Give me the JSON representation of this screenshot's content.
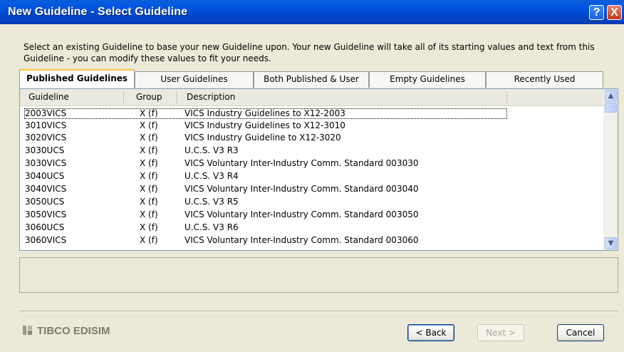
{
  "window": {
    "title": "New Guideline - Select Guideline",
    "help_glyph": "?",
    "close_glyph": "X"
  },
  "intro_text": "Select an existing Guideline to base your new Guideline upon. Your new Guideline will take all of its starting values and text from this Guideline - you can modify these values to fit your needs.",
  "tabs": [
    {
      "label": "Published Guidelines",
      "active": true
    },
    {
      "label": "User Guidelines",
      "active": false
    },
    {
      "label": "Both Published & User",
      "active": false
    },
    {
      "label": "Empty Guidelines",
      "active": false
    },
    {
      "label": "Recently Used",
      "active": false
    }
  ],
  "table": {
    "columns": [
      "Guideline",
      "Group",
      "Description"
    ],
    "rows": [
      {
        "guideline": "2003VICS",
        "group": "X (f)",
        "description": "VICS Industry Guidelines to X12-2003"
      },
      {
        "guideline": "3010VICS",
        "group": "X (f)",
        "description": "VICS Industry Guidelines to X12-3010"
      },
      {
        "guideline": "3020VICS",
        "group": "X (f)",
        "description": "VICS Industry Guideline to X12-3020"
      },
      {
        "guideline": "3030UCS",
        "group": "X (f)",
        "description": "U.C.S. V3 R3"
      },
      {
        "guideline": "3030VICS",
        "group": "X (f)",
        "description": "VICS Voluntary Inter-Industry Comm. Standard 003030"
      },
      {
        "guideline": "3040UCS",
        "group": "X (f)",
        "description": "U.C.S. V3 R4"
      },
      {
        "guideline": "3040VICS",
        "group": "X (f)",
        "description": "VICS Voluntary Inter-Industry Comm. Standard 003040"
      },
      {
        "guideline": "3050UCS",
        "group": "X (f)",
        "description": "U.C.S. V3 R5"
      },
      {
        "guideline": "3050VICS",
        "group": "X (f)",
        "description": "VICS Voluntary Inter-Industry Comm. Standard 003050"
      },
      {
        "guideline": "3060UCS",
        "group": "X (f)",
        "description": "U.C.S. V3 R6"
      },
      {
        "guideline": "3060VICS",
        "group": "X (f)",
        "description": "VICS Voluntary Inter-Industry Comm. Standard 003060"
      }
    ]
  },
  "icons": {
    "scroll_up": "chevron-up-icon",
    "scroll_down": "chevron-down-icon",
    "logo": "tibco-logo-icon"
  },
  "footer": {
    "logo_text": "TIBCO EDISIM",
    "back_label": "< Back",
    "next_label": "Next >",
    "cancel_label": "Cancel"
  },
  "colors": {
    "title_bar": "#0054E3",
    "active_tab_highlight": "#FFC83C",
    "dialog_background": "#ECE9D8"
  }
}
